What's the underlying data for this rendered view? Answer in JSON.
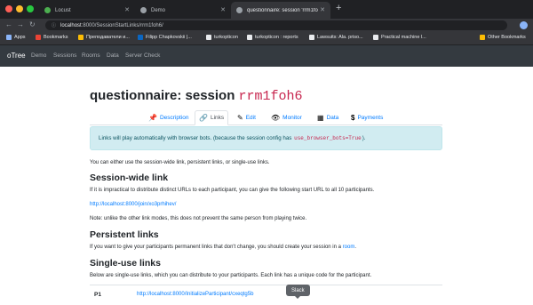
{
  "browser": {
    "tabs": [
      {
        "title": "Locust",
        "favicon_color": "#4caf50",
        "active": false
      },
      {
        "title": "Demo",
        "favicon_color": "#9aa0a6",
        "active": false
      },
      {
        "title": "questionnaire: session 'rrm1foh6'",
        "favicon_color": "#9aa0a6",
        "active": true
      }
    ],
    "new_tab": "+",
    "url": {
      "host": "localhost",
      "path": ":8000/SessionStartLinks/rrm1foh6/"
    },
    "bookmarks": [
      {
        "label": "Apps",
        "color": "#8ab4f8"
      },
      {
        "label": "Bookmarks",
        "color": "#ea4335"
      },
      {
        "label": "Преподаватели и...",
        "color": "#fbbc04"
      },
      {
        "label": "Filipp Chapkovskii |...",
        "color": "#0a66c2"
      },
      {
        "label": "turkopticon",
        "color": "#e8eaed"
      },
      {
        "label": "turkopticon : reports",
        "color": "#e8eaed"
      },
      {
        "label": "Lawsuits: Ala. priso...",
        "color": "#e8eaed"
      },
      {
        "label": "Practical machine l...",
        "color": "#e8eaed"
      },
      {
        "label": "Other Bookmarks",
        "color": "#fbbc04"
      }
    ]
  },
  "otree_nav": {
    "brand": "oTree",
    "links": [
      "Demo",
      "Sessions",
      "Rooms",
      "Data",
      "Server Check"
    ]
  },
  "page": {
    "title_prefix": "questionnaire: session",
    "session_code": "rrm1foh6",
    "tabs": [
      {
        "label": "Description",
        "icon": "pushpin-icon",
        "glyph": "📌"
      },
      {
        "label": "Links",
        "icon": "link-icon",
        "glyph": "🔗"
      },
      {
        "label": "Edit",
        "icon": "pencil-icon",
        "glyph": "✎"
      },
      {
        "label": "Monitor",
        "icon": "eye-icon",
        "glyph": "👁"
      },
      {
        "label": "Data",
        "icon": "table-icon",
        "glyph": "▦"
      },
      {
        "label": "Payments",
        "icon": "dollar-icon",
        "glyph": "$"
      }
    ],
    "alert": {
      "text": "Links will play automatically with browser bots. (because the session config has",
      "code": "use_browser_bots=True",
      "suffix": ")."
    },
    "intro": "You can either use the session-wide link, persistent links, or single-use links.",
    "session_wide": {
      "heading": "Session-wide link",
      "desc": "If it is impractical to distribute distinct URLs to each participant, you can give the following start URL to all 10 participants.",
      "url": "http://localhost:8000/join/xo3prhihev/",
      "note": "Note: unlike the other link modes, this does not prevent the same person from playing twice."
    },
    "persistent": {
      "heading": "Persistent links",
      "desc": "If you want to give your participants permanent links that don't change, you should create your session in a",
      "link": "room",
      "suffix": "."
    },
    "single_use": {
      "heading": "Single-use links",
      "desc": "Below are single-use links, which you can distribute to your participants. Each link has a unique code for the participant.",
      "rows": [
        {
          "label": "P1",
          "url": "http://localhost:8000/InitializeParticipant/cxeqtg5b"
        }
      ]
    }
  },
  "tooltip": "Slack"
}
